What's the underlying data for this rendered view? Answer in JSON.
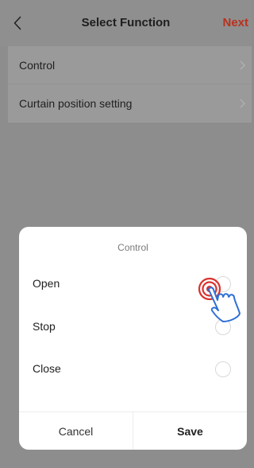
{
  "header": {
    "title": "Select Function",
    "next_label": "Next",
    "back_icon": "chevron-left-icon"
  },
  "list": {
    "items": [
      {
        "label": "Control",
        "icon": "chevron-right-icon"
      },
      {
        "label": "Curtain position setting",
        "icon": "chevron-right-icon"
      }
    ]
  },
  "sheet": {
    "title": "Control",
    "options": [
      {
        "label": "Open",
        "selected": true
      },
      {
        "label": "Stop",
        "selected": false
      },
      {
        "label": "Close",
        "selected": false
      }
    ],
    "cancel_label": "Cancel",
    "save_label": "Save"
  },
  "overlay": {
    "icon": "tap-hand-icon",
    "accent": "#d9322e",
    "stroke": "#2f6fd6"
  },
  "colors": {
    "accent": "#b8321f",
    "dimmed_bg": "#8d8d8d",
    "sheet_bg": "#ffffff"
  }
}
